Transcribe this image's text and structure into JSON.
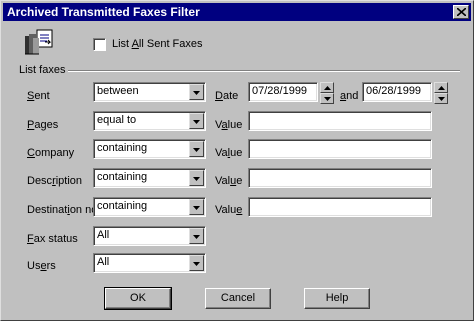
{
  "window": {
    "title": "Archived Transmitted Faxes Filter"
  },
  "list_all": {
    "label_pre": "List ",
    "label_ul": "A",
    "label_post": "ll Sent Faxes",
    "checked": false
  },
  "group": {
    "label": "List faxes"
  },
  "rows": {
    "sent": {
      "pre": "",
      "ul": "S",
      "post": "ent",
      "operator": "between",
      "value_label_pre": "",
      "value_label_ul": "D",
      "value_label_post": "ate",
      "date_from": "07/28/1999",
      "and_pre": "",
      "and_ul": "a",
      "and_post": "nd",
      "date_to": "06/28/1999"
    },
    "pages": {
      "pre": "",
      "ul": "P",
      "post": "ages",
      "operator": "equal to",
      "value_label_pre": "V",
      "value_label_ul": "a",
      "value_label_post": "lue",
      "value": ""
    },
    "company": {
      "pre": "",
      "ul": "C",
      "post": "ompany",
      "operator": "containing",
      "value_label_pre": "Va",
      "value_label_ul": "l",
      "value_label_post": "ue",
      "value": ""
    },
    "description": {
      "pre": "Desc",
      "ul": "r",
      "post": "iption",
      "operator": "containing",
      "value_label_pre": "Val",
      "value_label_ul": "u",
      "value_label_post": "e",
      "value": ""
    },
    "destination": {
      "pre": "Destinat",
      "ul": "i",
      "post": "on no",
      "operator": "containing",
      "value_label_pre": "Valu",
      "value_label_ul": "e",
      "value_label_post": "",
      "value": ""
    },
    "fax_status": {
      "pre": "",
      "ul": "F",
      "post": "ax status",
      "value": "All"
    },
    "users": {
      "pre": "Us",
      "ul": "e",
      "post": "rs",
      "value": "All"
    }
  },
  "buttons": {
    "ok": "OK",
    "cancel": "Cancel",
    "help": "Help"
  },
  "colors": {
    "titlebar": "#000080",
    "face": "#c0c0c0"
  },
  "icons": {
    "dialog": "fax-archive-icon",
    "close": "close-icon",
    "dropdown": "chevron-down-icon"
  }
}
